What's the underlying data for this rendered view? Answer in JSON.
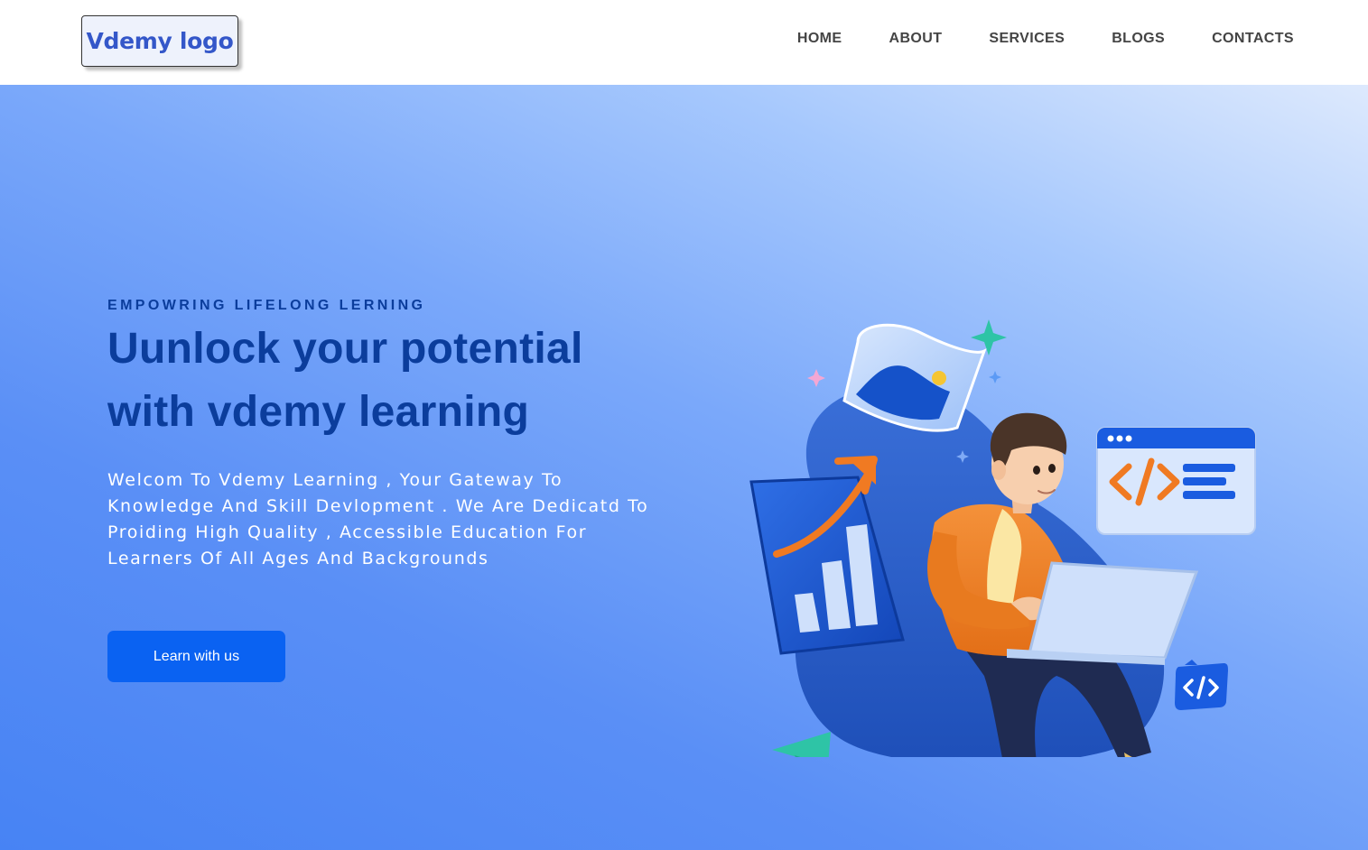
{
  "header": {
    "logo_text": "Vdemy logo",
    "nav": [
      "HOME",
      "ABOUT",
      "SERVICES",
      "BLOGS",
      "CONTACTS"
    ]
  },
  "hero": {
    "eyebrow": "EMPOWRING LIFELONG LERNING",
    "headline_line1": "Uunlock your potential",
    "headline_line2": "with vdemy learning",
    "description": "Welcom To Vdemy Learning , Your Gateway To Knowledge And Skill Devlopment . We Are Dedicatd To Proiding High Quality , Accessible Education For Learners Of All Ages And Backgrounds",
    "cta_label": "Learn with us"
  },
  "illustration": {
    "icons": [
      "bar-chart-icon",
      "image-icon",
      "code-window-icon",
      "code-badge-icon",
      "paper-plane-icon",
      "sparkle-icon",
      "laptop-icon"
    ]
  },
  "colors": {
    "primary": "#0a62f2",
    "heading": "#0b3d9c",
    "logo_text": "#3457c9"
  }
}
